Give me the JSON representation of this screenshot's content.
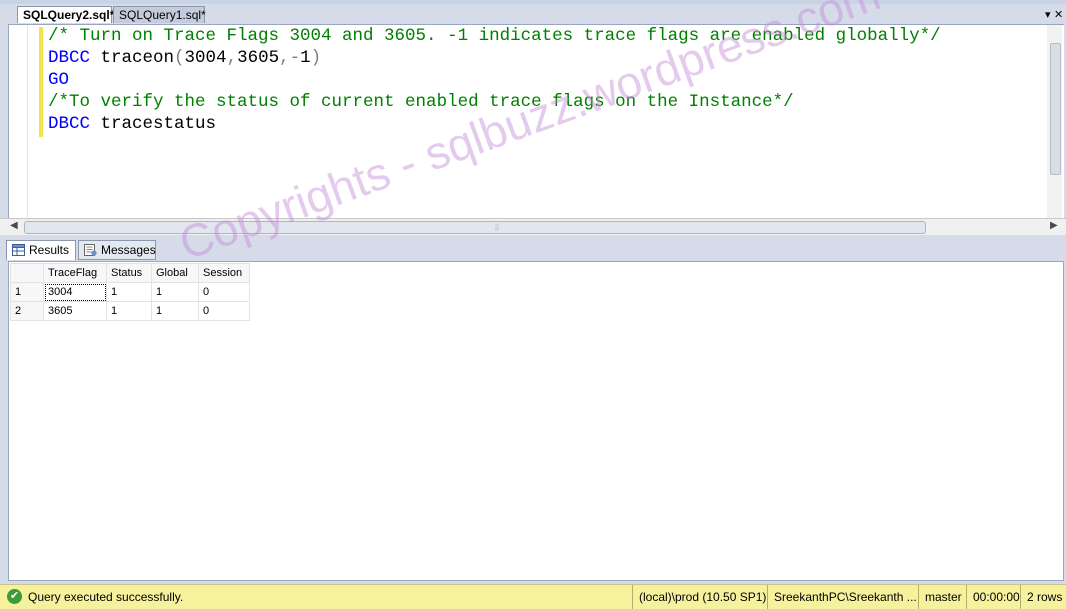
{
  "tabs": [
    {
      "label": "SQLQuery2.sql*",
      "active": true
    },
    {
      "label": "SQLQuery1.sql*",
      "active": false
    }
  ],
  "tab_controls": {
    "dropdown": "▾",
    "close": "✕"
  },
  "code_lines": [
    {
      "parts": [
        {
          "text": "/* Turn on Trace Flags 3004 and 3605. -1 indicates trace flags are enabled globally*/",
          "cls": "c-comment"
        }
      ]
    },
    {
      "parts": [
        {
          "text": "DBCC ",
          "cls": "c-kw"
        },
        {
          "text": "traceon",
          "cls": "c-black"
        },
        {
          "text": "(",
          "cls": "c-gray"
        },
        {
          "text": "3004",
          "cls": "c-black"
        },
        {
          "text": ",",
          "cls": "c-gray"
        },
        {
          "text": "3605",
          "cls": "c-black"
        },
        {
          "text": ",-",
          "cls": "c-gray"
        },
        {
          "text": "1",
          "cls": "c-black"
        },
        {
          "text": ")",
          "cls": "c-gray"
        }
      ]
    },
    {
      "parts": [
        {
          "text": "GO",
          "cls": "c-kw"
        }
      ]
    },
    {
      "parts": [
        {
          "text": "/*To verify the status of current enabled trace flags on the Instance*/",
          "cls": "c-comment"
        }
      ]
    },
    {
      "parts": [
        {
          "text": "DBCC ",
          "cls": "c-kw"
        },
        {
          "text": "tracestatus",
          "cls": "c-black"
        }
      ]
    }
  ],
  "results_tabs": [
    {
      "label": "Results",
      "icon": "grid-icon",
      "active": true
    },
    {
      "label": "Messages",
      "icon": "messages-icon",
      "active": false
    }
  ],
  "grid": {
    "columns": [
      "TraceFlag",
      "Status",
      "Global",
      "Session"
    ],
    "rows": [
      {
        "num": "1",
        "cells": [
          "3004",
          "1",
          "1",
          "0"
        ]
      },
      {
        "num": "2",
        "cells": [
          "3605",
          "1",
          "1",
          "0"
        ]
      }
    ]
  },
  "watermark": "Copyrights - sqlbuzz.wordpress.com",
  "status": {
    "message": "Query executed successfully.",
    "server": "(local)\\prod (10.50 SP1)",
    "user": "SreekanthPC\\Sreekanth ...",
    "database": "master",
    "elapsed": "00:00:00",
    "rows": "2 rows"
  },
  "colors": {
    "status_bar": "#f6f19c",
    "comment": "#008000",
    "keyword": "#0000ff"
  }
}
